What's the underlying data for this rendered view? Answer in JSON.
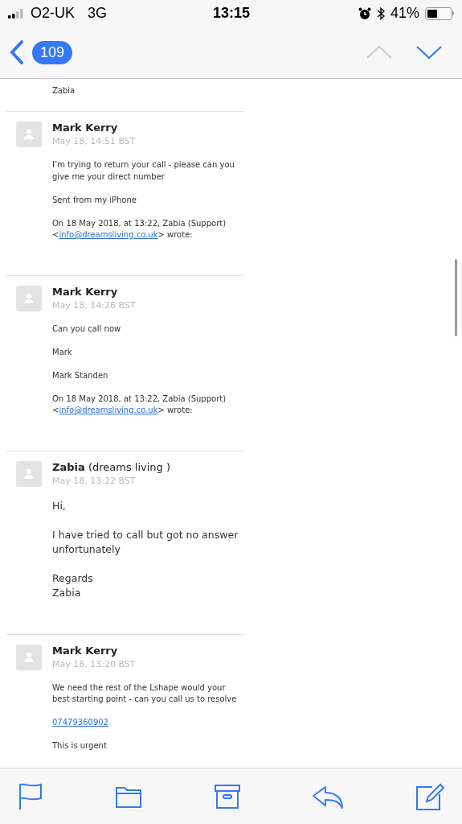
{
  "status_bar": {
    "carrier": "O2-UK",
    "network": "3G",
    "time": "13:15",
    "battery": "41%"
  },
  "nav": {
    "count": "109",
    "previous_disabled": true,
    "next_disabled": false
  },
  "cut_line": "Zabia",
  "messages": [
    {
      "sender": "Mark Kerry",
      "date": "May 18, 14:51 BST",
      "kind": "compact",
      "paragraphs": [
        [
          {
            "kind": "text",
            "text": "I’m trying to return your call - please can you give me your direct number"
          }
        ],
        [
          {
            "kind": "text",
            "text": "Sent from my iPhone"
          }
        ],
        [
          {
            "kind": "text",
            "text": "On 18 May 2018, at 13:22, Zabia (Support) <"
          },
          {
            "kind": "link",
            "text": "info@dreamsliving.co.uk"
          },
          {
            "kind": "text",
            "text": "> wrote:"
          }
        ]
      ]
    },
    {
      "sender": "Mark Kerry",
      "date": "May 18, 14:26 BST",
      "kind": "compact",
      "paragraphs": [
        [
          {
            "kind": "text",
            "text": "Can you call now"
          }
        ],
        [
          {
            "kind": "text",
            "text": "Mark"
          }
        ],
        [
          {
            "kind": "text",
            "text": "Mark Standen"
          }
        ],
        [
          {
            "kind": "text",
            "text": "On 18 May 2018, at 13:22, Zabia (Support) <"
          },
          {
            "kind": "link",
            "text": "info@dreamsliving.co.uk"
          },
          {
            "kind": "text",
            "text": "> wrote:"
          }
        ]
      ]
    },
    {
      "sender": "Zabia",
      "org": "(dreams living )",
      "date": "May 18, 13:22 BST",
      "kind": "roomy",
      "paragraphs": [
        [
          {
            "kind": "text",
            "text": "Hi,"
          }
        ],
        [
          {
            "kind": "text",
            "text": "I have tried to call but got no answer unfortunately"
          }
        ],
        [
          {
            "kind": "text",
            "text": "Regards\nZabia"
          }
        ]
      ]
    },
    {
      "sender": "Mark Kerry",
      "date": "May 18, 13:20 BST",
      "kind": "compact",
      "paragraphs": [
        [
          {
            "kind": "text",
            "text": "We need the rest of the Lshape would your best starting point - can you call us to resolve"
          }
        ],
        [
          {
            "kind": "link",
            "text": "07479360902"
          }
        ],
        [
          {
            "kind": "text",
            "text": "This is urgent"
          }
        ]
      ]
    }
  ]
}
